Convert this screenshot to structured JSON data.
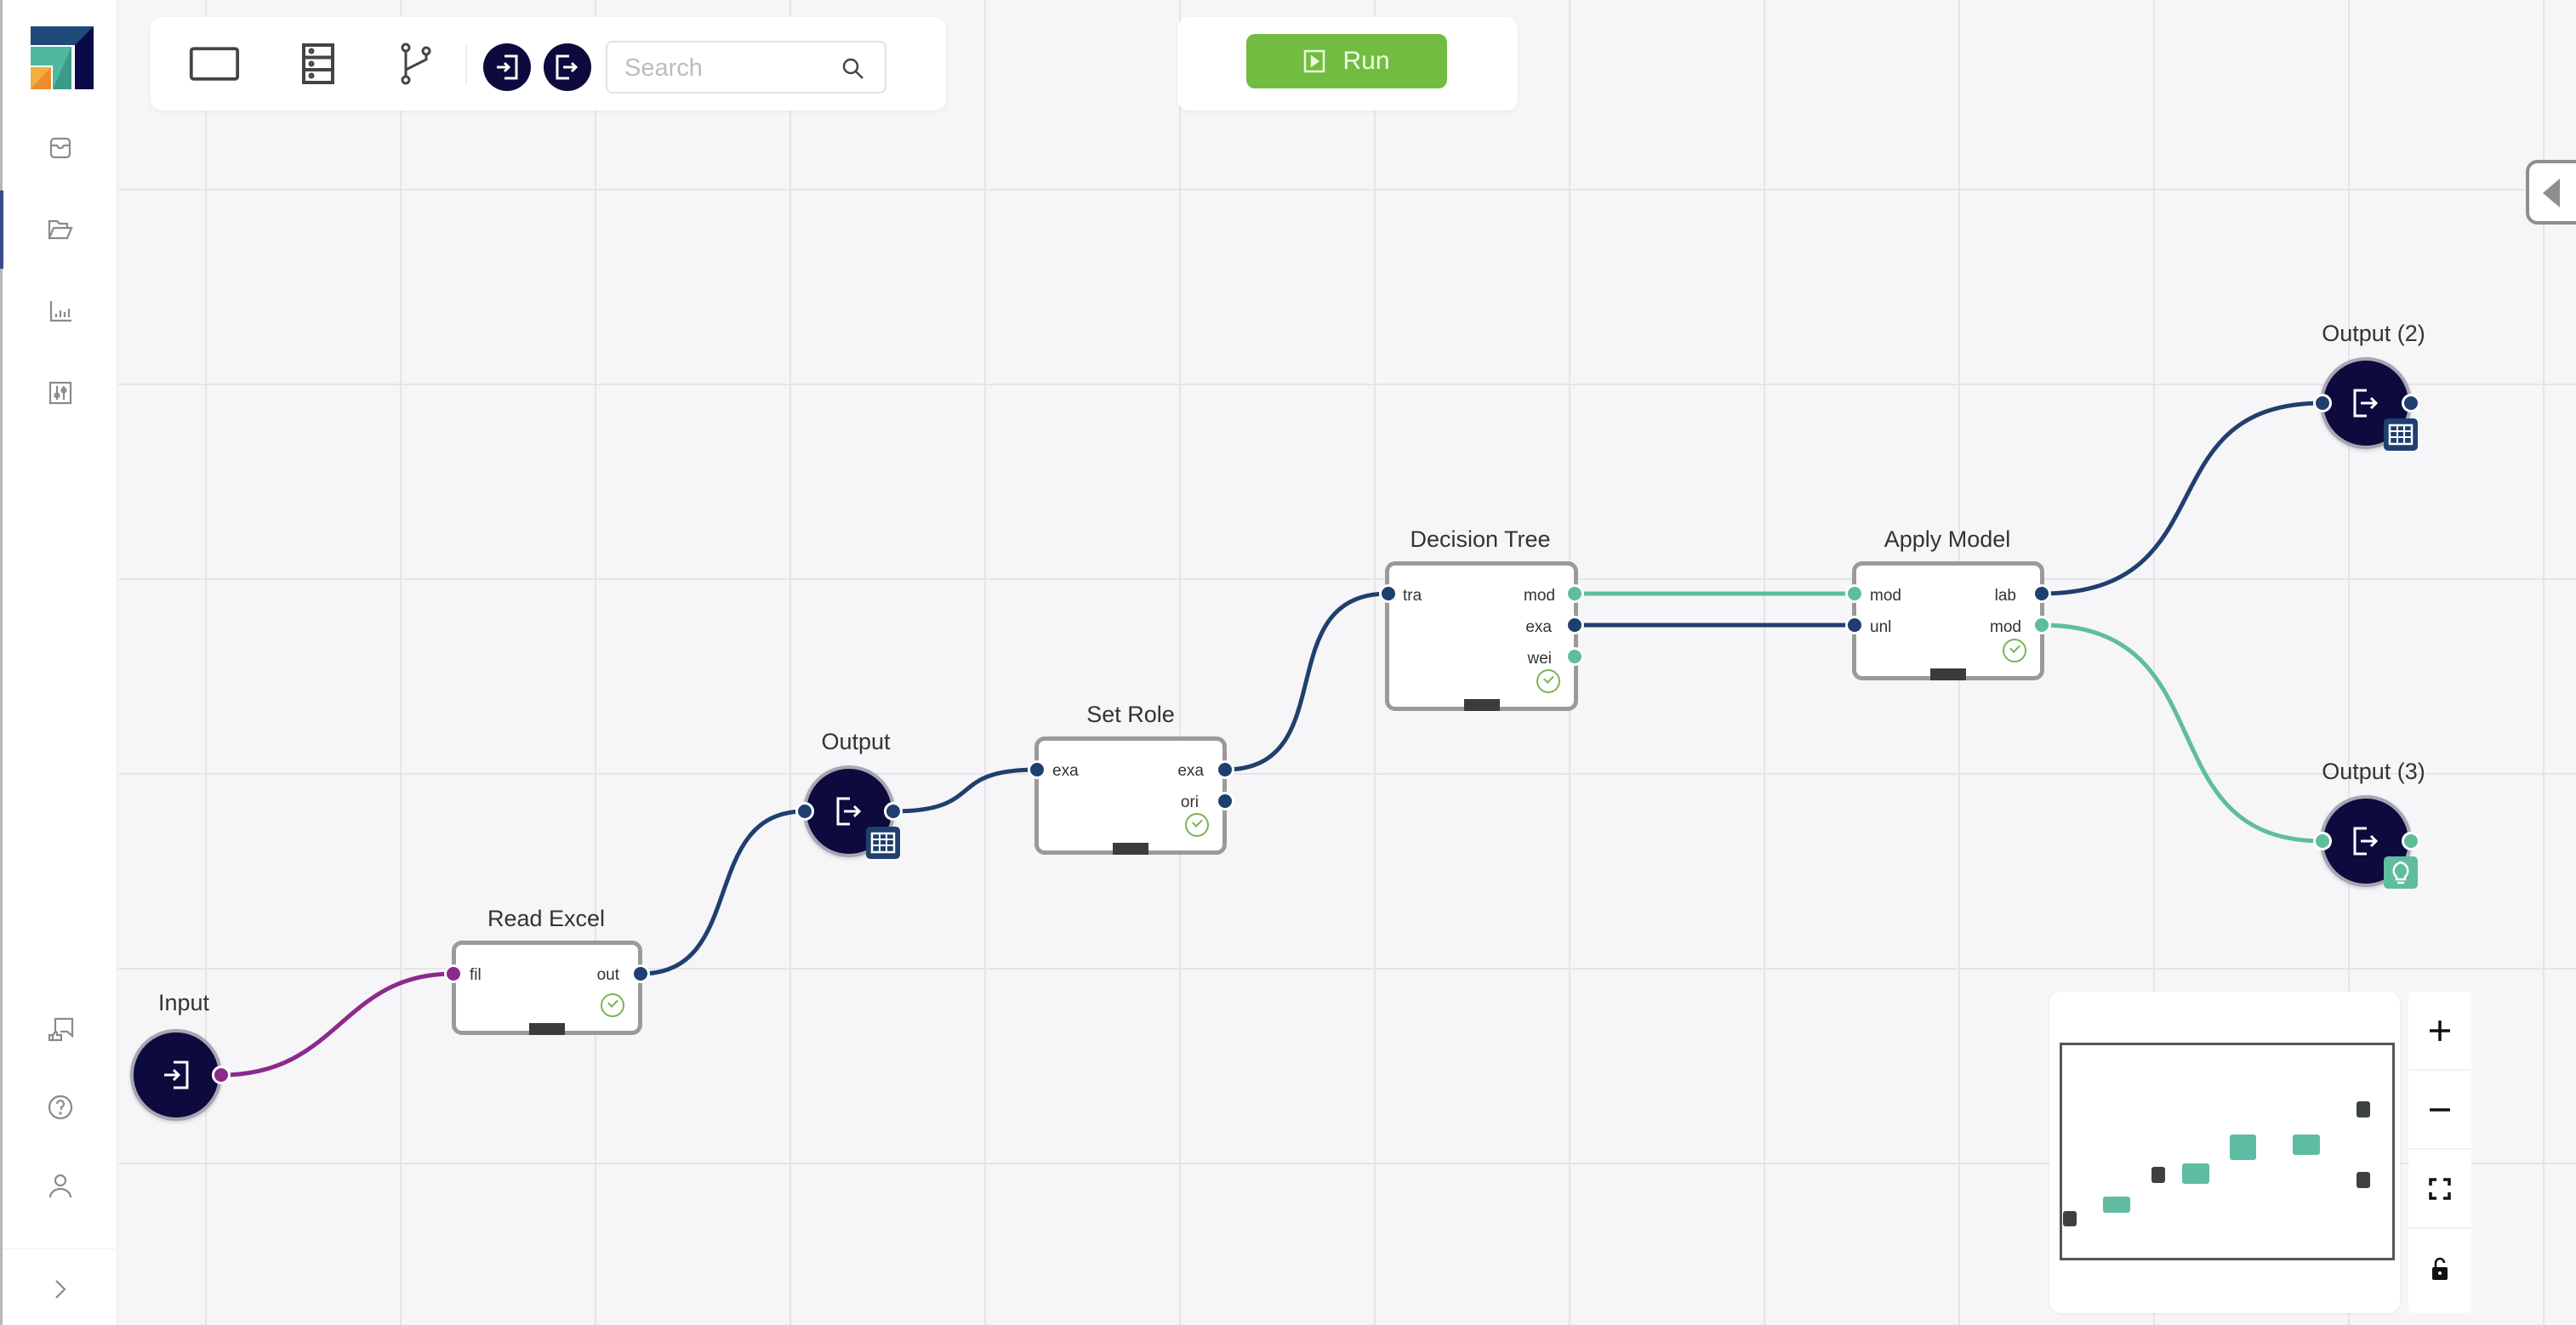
{
  "sidebar": {
    "logo": "app-logo",
    "top_items": [
      {
        "id": "inbox",
        "icon": "inbox-icon",
        "active": false
      },
      {
        "id": "projects",
        "icon": "folder-open-icon",
        "active": true
      },
      {
        "id": "analytics",
        "icon": "bar-chart-icon",
        "active": false
      },
      {
        "id": "settings",
        "icon": "sliders-icon",
        "active": false
      }
    ],
    "bottom_items": [
      {
        "id": "feedback",
        "icon": "feedback-icon"
      },
      {
        "id": "help",
        "icon": "help-icon"
      },
      {
        "id": "account",
        "icon": "user-icon"
      },
      {
        "id": "expand",
        "icon": "chevron-right-icon"
      }
    ]
  },
  "toolbar": {
    "tools": [
      "frame-tool-icon",
      "storage-tool-icon",
      "branch-tool-icon"
    ],
    "io_buttons": [
      "input-node-icon",
      "output-node-icon"
    ],
    "search": {
      "placeholder": "Search",
      "value": ""
    }
  },
  "run": {
    "label": "Run",
    "color": "#72bd41"
  },
  "colors": {
    "node_dark": "#0d0a3e",
    "port_navy": "#1f3f6e",
    "port_teal": "#5fbd9e",
    "port_purple": "#8a2a8d",
    "success": "#7ab550"
  },
  "workflow": {
    "nodes": {
      "input": {
        "label": "Input",
        "type": "input"
      },
      "read_excel": {
        "label": "Read Excel",
        "inputs": [
          "fil"
        ],
        "outputs": [
          "out"
        ],
        "status": "success"
      },
      "output1": {
        "label": "Output",
        "type": "output",
        "badge": "table-icon"
      },
      "set_role": {
        "label": "Set Role",
        "inputs": [
          "exa"
        ],
        "outputs": [
          "exa",
          "ori"
        ],
        "status": "success"
      },
      "decision_tree": {
        "label": "Decision Tree",
        "inputs": [
          "tra"
        ],
        "outputs": [
          "mod",
          "exa",
          "wei"
        ],
        "status": "success"
      },
      "apply_model": {
        "label": "Apply Model",
        "inputs": [
          "mod",
          "unl"
        ],
        "outputs": [
          "lab",
          "mod"
        ],
        "status": "success"
      },
      "output2": {
        "label": "Output (2)",
        "type": "output",
        "badge": "table-icon"
      },
      "output3": {
        "label": "Output (3)",
        "type": "output",
        "badge": "lightbulb-icon"
      }
    },
    "links": [
      {
        "from": "input.out",
        "to": "read_excel.fil",
        "kind": "file"
      },
      {
        "from": "read_excel.out",
        "to": "output1.in",
        "kind": "data"
      },
      {
        "from": "output1.out",
        "to": "set_role.exa",
        "kind": "data"
      },
      {
        "from": "set_role.exa",
        "to": "decision_tree.tra",
        "kind": "data"
      },
      {
        "from": "decision_tree.mod",
        "to": "apply_model.mod",
        "kind": "model"
      },
      {
        "from": "decision_tree.exa",
        "to": "apply_model.unl",
        "kind": "data"
      },
      {
        "from": "apply_model.lab",
        "to": "output2.in",
        "kind": "data"
      },
      {
        "from": "apply_model.mod",
        "to": "output3.in",
        "kind": "model"
      }
    ]
  },
  "zoom_controls": [
    "zoom-in-icon",
    "zoom-out-icon",
    "fit-view-icon",
    "lock-open-icon"
  ]
}
